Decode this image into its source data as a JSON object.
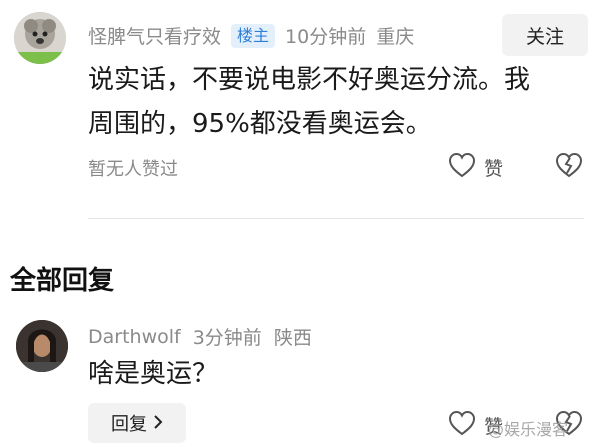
{
  "post": {
    "author": "怪脾气只看疗效",
    "badge": "楼主",
    "time": "10分钟前",
    "location": "重庆",
    "follow_label": "关注",
    "text_line1": "说实话，不要说电影不好奥运分流。我",
    "text_line2": "周围的，95%都没看奥运会。",
    "likes_text": "暂无人赞过",
    "like_label": "赞"
  },
  "replies_section": {
    "title": "全部回复"
  },
  "reply": {
    "author": "Darthwolf",
    "time": "3分钟前",
    "location": "陕西",
    "text": "啥是奥运？",
    "reply_button_label": "回复",
    "like_label": "赞"
  },
  "watermark": "@娱乐漫客",
  "icons": {
    "heart": "heart-icon",
    "dislike": "broken-heart-icon",
    "chevron": "chevron-right-icon"
  }
}
